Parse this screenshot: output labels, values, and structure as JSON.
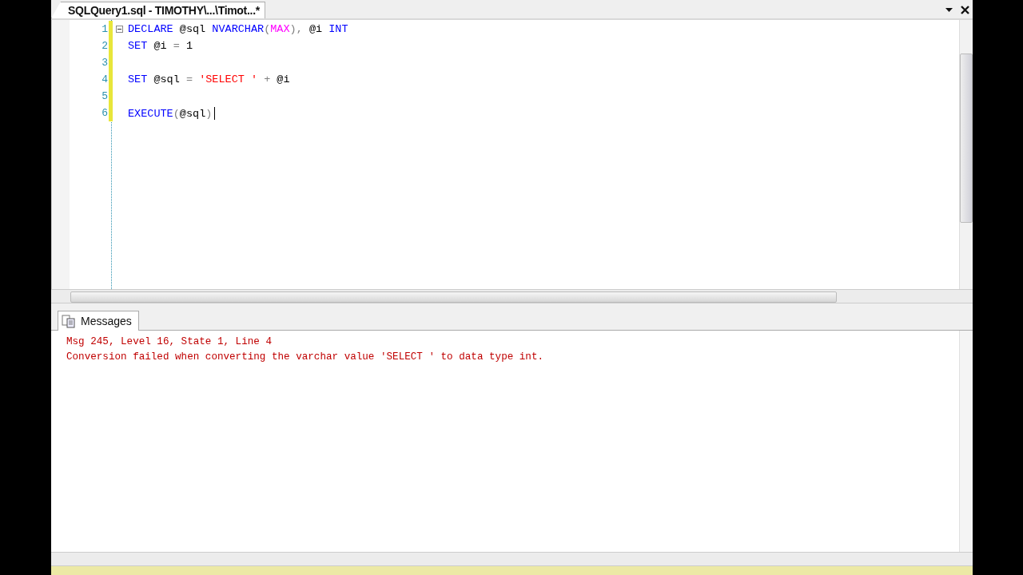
{
  "document_tab": {
    "title": "SQLQuery1.sql - TIMOTHY\\...\\Timot...*",
    "selected": true
  },
  "editor": {
    "lines": [
      {
        "number": "1",
        "tokens": [
          {
            "text": "DECLARE ",
            "kind": "keyword"
          },
          {
            "text": "@sql ",
            "kind": "plain"
          },
          {
            "text": "NVARCHAR",
            "kind": "keyword"
          },
          {
            "text": "(",
            "kind": "operator"
          },
          {
            "text": "MAX",
            "kind": "function"
          },
          {
            "text": "), ",
            "kind": "operator"
          },
          {
            "text": "@i ",
            "kind": "plain"
          },
          {
            "text": "INT",
            "kind": "keyword"
          }
        ]
      },
      {
        "number": "2",
        "tokens": [
          {
            "text": "SET ",
            "kind": "keyword"
          },
          {
            "text": "@i ",
            "kind": "plain"
          },
          {
            "text": "= ",
            "kind": "operator"
          },
          {
            "text": "1",
            "kind": "plain"
          }
        ]
      },
      {
        "number": "3"
      },
      {
        "number": "4",
        "tokens": [
          {
            "text": "SET ",
            "kind": "keyword"
          },
          {
            "text": "@sql ",
            "kind": "plain"
          },
          {
            "text": "= ",
            "kind": "operator"
          },
          {
            "text": "'SELECT '",
            "kind": "string"
          },
          {
            "text": " + ",
            "kind": "operator"
          },
          {
            "text": "@i",
            "kind": "plain"
          }
        ]
      },
      {
        "number": "5"
      },
      {
        "number": "6",
        "tokens": [
          {
            "text": "EXECUTE",
            "kind": "keyword"
          },
          {
            "text": "(",
            "kind": "operator"
          },
          {
            "text": "@sql",
            "kind": "plain"
          },
          {
            "text": ")",
            "kind": "operator"
          }
        ]
      }
    ]
  },
  "results_tabs": [
    {
      "label": "Messages",
      "selected": true
    }
  ],
  "messages": [
    "Msg 245, Level 16, State 1, Line 4",
    "Conversion failed when converting the varchar value 'SELECT ' to data type int."
  ]
}
